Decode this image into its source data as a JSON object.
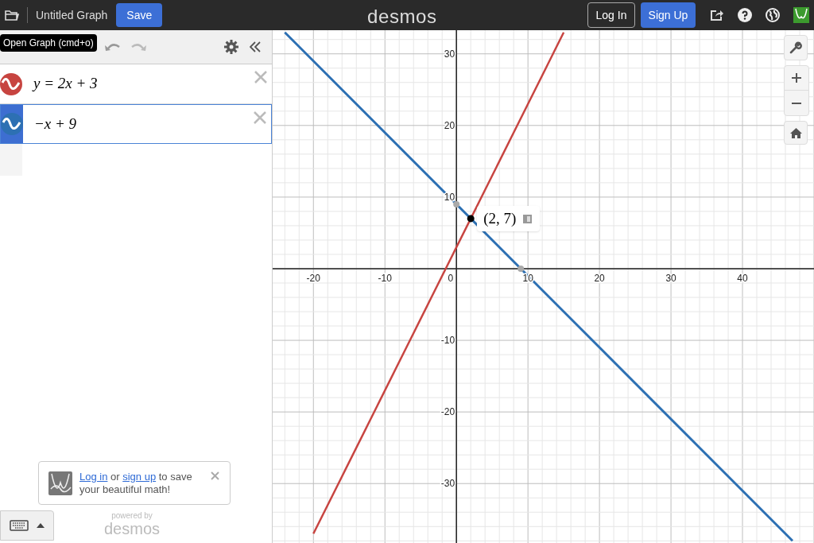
{
  "header": {
    "title": "Untitled Graph",
    "save": "Save",
    "logo": "desmos",
    "login": "Log In",
    "signup": "Sign Up"
  },
  "tooltip": "Open Graph (cmd+o)",
  "expressions": [
    {
      "latex": "y = 2x + 3",
      "color": "#c74440",
      "selected": false
    },
    {
      "latex": "−x + 9",
      "color": "#2d70b3",
      "selected": true
    }
  ],
  "login_prompt": {
    "login_link": "Log in",
    "or": " or ",
    "signup_link": "sign up",
    "rest": " to save your beautiful math!"
  },
  "powered_by": {
    "caption": "powered by",
    "brand": "desmos"
  },
  "graph": {
    "origin_label": "0",
    "chart_data": {
      "type": "line",
      "grid": true,
      "x": [
        -24,
        -20,
        15,
        47
      ],
      "series": [
        {
          "color": "#c74440",
          "values": [
            null,
            -37,
            33,
            null
          ]
        },
        {
          "color": "#2d70b3",
          "values": [
            33,
            29,
            -6,
            -38
          ]
        }
      ],
      "xlim": [
        -25.7,
        50
      ],
      "ylim": [
        -38.3,
        33.3
      ],
      "xticks": [
        -20,
        -10,
        10,
        20,
        30,
        40
      ],
      "yticks": [
        -30,
        -20,
        -10,
        10,
        20,
        30
      ],
      "annotations": [
        {
          "x": 2,
          "y": 7,
          "text": "(2, 7)"
        }
      ]
    }
  }
}
